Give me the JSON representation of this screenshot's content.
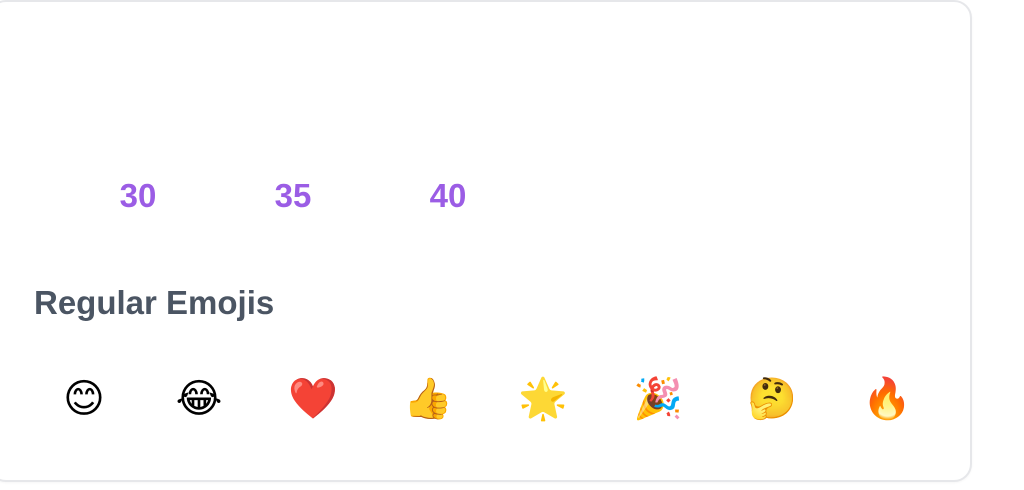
{
  "numbers": [
    "30",
    "35",
    "40"
  ],
  "section": {
    "title": "Regular Emojis"
  },
  "emojis": [
    {
      "char": "😊",
      "name": "smiling-face"
    },
    {
      "char": "😂",
      "name": "tears-of-joy"
    },
    {
      "char": "❤️",
      "name": "red-heart"
    },
    {
      "char": "👍",
      "name": "thumbs-up"
    },
    {
      "char": "🌟",
      "name": "glowing-star"
    },
    {
      "char": "🎉",
      "name": "party-popper"
    },
    {
      "char": "🤔",
      "name": "thinking-face"
    },
    {
      "char": "🔥",
      "name": "fire"
    }
  ],
  "colors": {
    "number": "#9b5de5",
    "title": "#4b5563",
    "border": "#e6e7ea"
  }
}
